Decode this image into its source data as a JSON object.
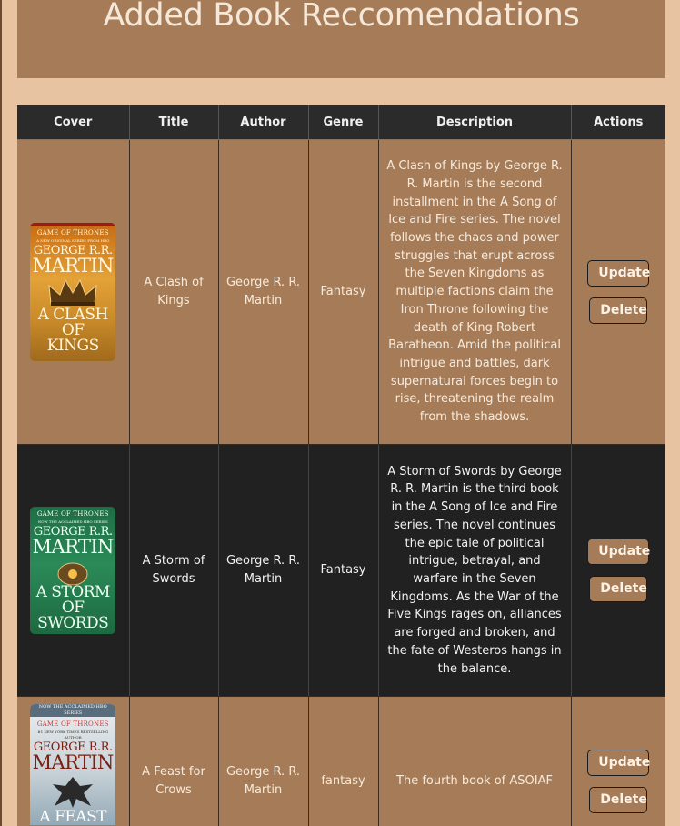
{
  "page": {
    "heading": "Added Book Reccomendations"
  },
  "table": {
    "headers": [
      "Cover",
      "Title",
      "Author",
      "Genre",
      "Description",
      "Actions"
    ],
    "rows": [
      {
        "cover": {
          "series": "GAME OF THRONES",
          "banner": "A NEW ORIGINAL SERIES FROM HBO",
          "author_line1": "GEORGE R.R.",
          "author_line2": "MARTIN",
          "title_line1": "A CLASH OF",
          "title_line2": "KINGS"
        },
        "title": "A Clash of Kings",
        "author": "George R. R. Martin",
        "genre": "Fantasy",
        "description": "A Clash of Kings by George R. R. Martin is the second installment in the A Song of Ice and Fire series. The novel follows the chaos and power struggles that erupt across the Seven Kingdoms as multiple factions claim the Iron Throne following the death of King Robert Baratheon. Amid the political intrigue and battles, dark supernatural forces begin to rise, threatening the realm from the shadows.",
        "update_label": "Update",
        "delete_label": "Delete"
      },
      {
        "cover": {
          "series": "GAME OF THRONES",
          "banner": "NOW THE ACCLAIMED HBO SERIES",
          "author_line1": "GEORGE R.R.",
          "author_line2": "MARTIN",
          "title_line1": "A STORM OF",
          "title_line2": "SWORDS"
        },
        "title": "A Storm of Swords",
        "author": "George R. R. Martin",
        "genre": "Fantasy",
        "description": "A Storm of Swords by George R. R. Martin is the third book in the A Song of Ice and Fire series. The novel continues the epic tale of political intrigue, betrayal, and warfare in the Seven Kingdoms. As the War of the Five Kings rages on, alliances are forged and broken, and the fate of Westeros hangs in the balance.",
        "update_label": "Update",
        "delete_label": "Delete"
      },
      {
        "cover": {
          "top": "NOW THE ACCLAIMED HBO SERIES",
          "series": "GAME OF THRONES",
          "banner": "#1 NEW YORK TIMES BESTSELLING AUTHOR",
          "author_line1": "GEORGE R.R.",
          "author_line2": "MARTIN",
          "title_line1": "A FEAST"
        },
        "title": "A Feast for Crows",
        "author": "George R. R. Martin",
        "genre": "fantasy",
        "description": "The fourth book of ASOIAF",
        "update_label": "Update",
        "delete_label": "Delete"
      }
    ]
  },
  "colors": {
    "page_background": "#e8c3a2",
    "accent_brown": "#a67c58",
    "dark_row": "#212121",
    "header_row": "#2b2b2b"
  }
}
